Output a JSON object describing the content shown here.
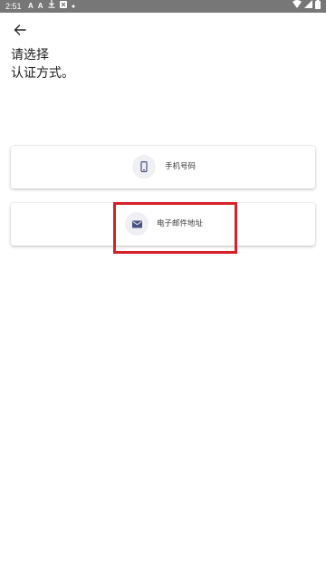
{
  "status_bar": {
    "time": "2:51",
    "left_icons": [
      "A",
      "A"
    ],
    "bg_color": "#777777"
  },
  "header": {
    "back_icon": "arrow-left-icon",
    "title": "请选择\n认证方式。"
  },
  "options": [
    {
      "id": "phone",
      "icon": "smartphone-icon",
      "label": "手机号码"
    },
    {
      "id": "email",
      "icon": "mail-icon",
      "label": "电子邮件地址"
    }
  ],
  "colors": {
    "highlight": "#d6202a",
    "icon": "#4a5280",
    "icon_bg": "#f0f0f4"
  }
}
